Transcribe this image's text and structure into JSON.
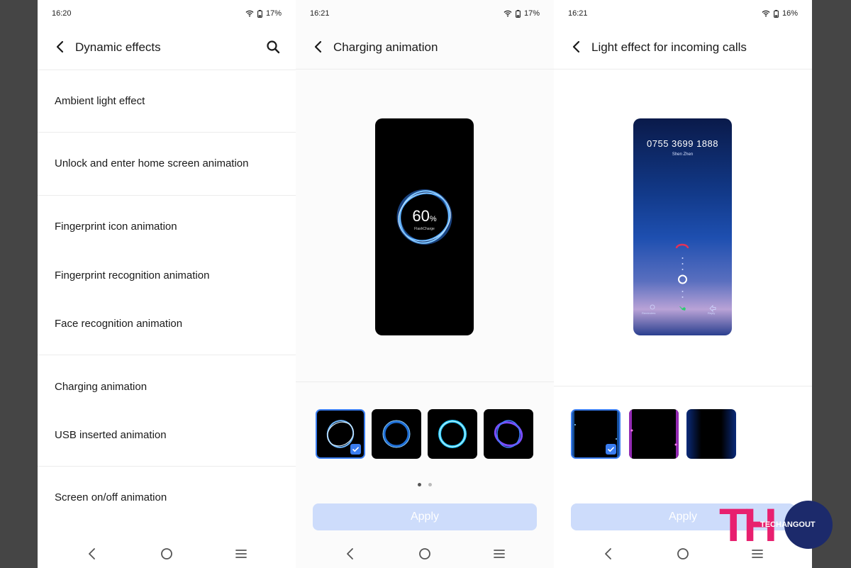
{
  "panel1": {
    "status": {
      "time": "16:20",
      "battery": "17%"
    },
    "title": "Dynamic effects",
    "items": [
      "Ambient light effect",
      "Unlock and enter home screen animation",
      "Fingerprint icon animation",
      "Fingerprint recognition animation",
      "Face recognition animation",
      "Charging animation",
      "USB inserted animation",
      "Screen on/off animation"
    ]
  },
  "panel2": {
    "status": {
      "time": "16:21",
      "battery": "17%"
    },
    "title": "Charging animation",
    "preview": {
      "percent": "60",
      "percent_sign": "%",
      "brand": "FlashCharge"
    },
    "page_indicator": {
      "current": 1,
      "total": 2
    },
    "apply_label": "Apply"
  },
  "panel3": {
    "status": {
      "time": "16:21",
      "battery": "16%"
    },
    "title": "Light effect for incoming calls",
    "preview": {
      "number": "0755 3699 1888",
      "location": "Shen Zhen",
      "left_action": "Reminders",
      "right_action": "Reply"
    },
    "apply_label": "Apply"
  },
  "watermark": {
    "letters": "TH",
    "text": "TECHANGOUT"
  },
  "colors": {
    "accent": "#3a7df0",
    "apply_disabled": "#cddcfb",
    "logo_pink": "#e8206f",
    "logo_navy": "#1c2a6b"
  }
}
